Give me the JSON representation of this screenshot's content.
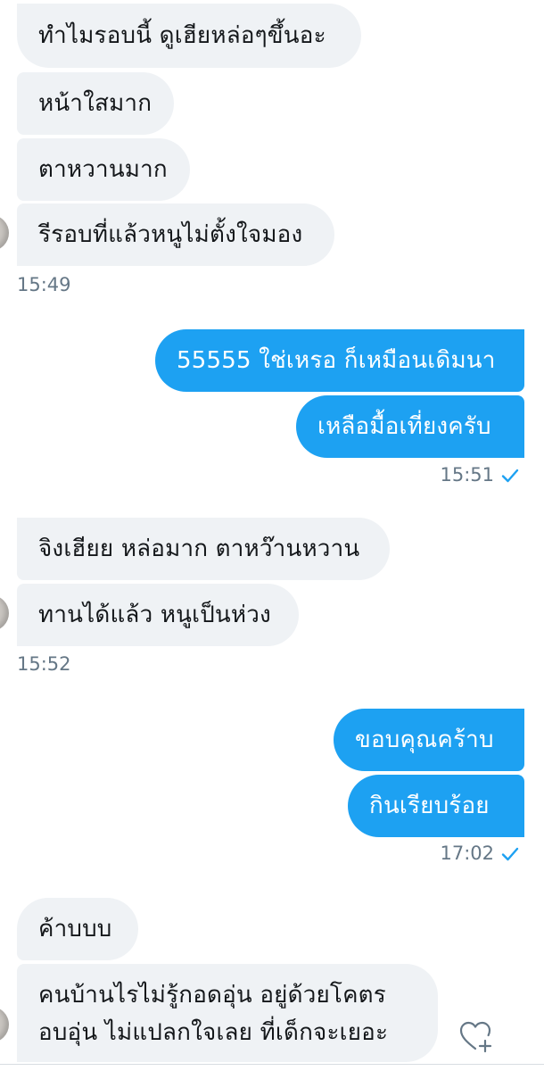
{
  "conversation": {
    "group1": {
      "messages": [
        "ทำไมรอบนี้ ดูเฮียหล่อๆขึ้นอะ",
        "หน้าใสมาก",
        "ตาหวานมาก",
        "รีรอบที่แล้วหนูไม่ตั้งใจมอง"
      ],
      "time": "15:49"
    },
    "group2": {
      "messages": [
        "55555 ใช่เหรอ ก็เหมือนเดิมนา",
        "เหลือมื้อเที่ยงครับ"
      ],
      "time": "15:51"
    },
    "group3": {
      "messages": [
        "จิงเฮียย หล่อมาก ตาหว๊านหวาน",
        "ทานได้แล้ว หนูเป็นห่วง"
      ],
      "time": "15:52"
    },
    "group4": {
      "messages": [
        "ขอบคุณคร้าบ",
        "กินเรียบร้อย"
      ],
      "time": "17:02"
    },
    "group5": {
      "messages": [
        "ค้าบบบ",
        "คนบ้านไรไม่รู้กอดอุ่น  อยู่ด้วยโคตรอบอุ่น ไม่แปลกใจเลย ที่เด็กจะเยอะ"
      ]
    }
  },
  "colors": {
    "incoming_bubble": "#eff2f5",
    "outgoing_bubble": "#1da1f2",
    "timestamp": "#657786",
    "read_check": "#1da1f2"
  },
  "icons": {
    "read_receipt": "check-icon",
    "like": "heart-plus-icon"
  }
}
